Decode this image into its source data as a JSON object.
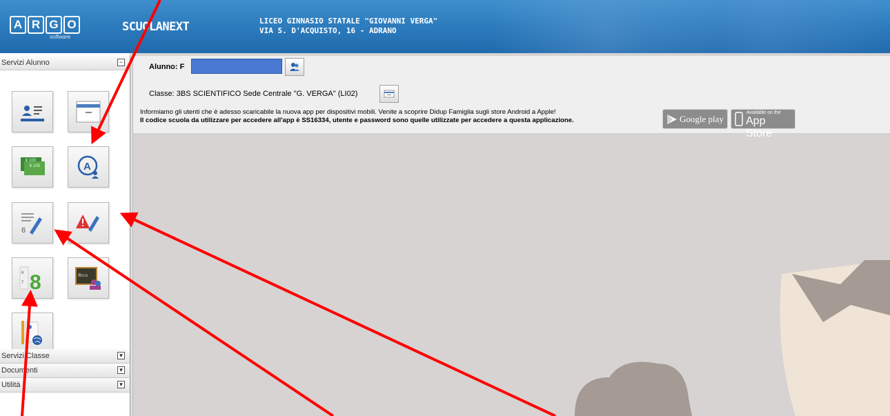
{
  "header": {
    "logo_letters": [
      "A",
      "R",
      "G",
      "O"
    ],
    "logo_sub": "software",
    "app_name": "SCUOLANEXT",
    "school_name": "LICEO GINNASIO STATALE \"GIOVANNI VERGA\"",
    "school_address": "VIA S. D'ACQUISTO, 16 - ADRANO"
  },
  "sidebar": {
    "sections": [
      {
        "label": "Servizi Alunno",
        "expanded": true
      },
      {
        "label": "Servizi Classe",
        "expanded": false
      },
      {
        "label": "Documenti",
        "expanded": false
      },
      {
        "label": "Utilità",
        "expanded": false
      }
    ],
    "icons": [
      "student-profile-icon",
      "archive-box-icon",
      "tax-payments-icon",
      "absences-icon",
      "grades-icon",
      "notes-icon",
      "report-card-icon",
      "reception-icon",
      "curriculum-globe-icon"
    ]
  },
  "main": {
    "student_label": "Alunno: F",
    "class_label": "Classe: 3BS SCIENTIFICO Sede Centrale \"G. VERGA\" (LI02)",
    "message_line1": "Informiamo gli utenti che è adesso scaricabile la nuova app per dispositivi mobili. Venite a scoprire Didup Famiglia sugli store Android a Apple!",
    "message_line2": "Il codice scuola da utilizzare per accedere all'app è SS16334, utente e password sono quelle utilizzate per accedere a questa applicazione.",
    "google_play_label": "Google play",
    "app_store_small": "Available on the",
    "app_store_label": "App Store"
  },
  "colors": {
    "header_blue": "#2f7fc0",
    "annotation_red": "#ff0000",
    "student_field": "#4a79d3"
  }
}
